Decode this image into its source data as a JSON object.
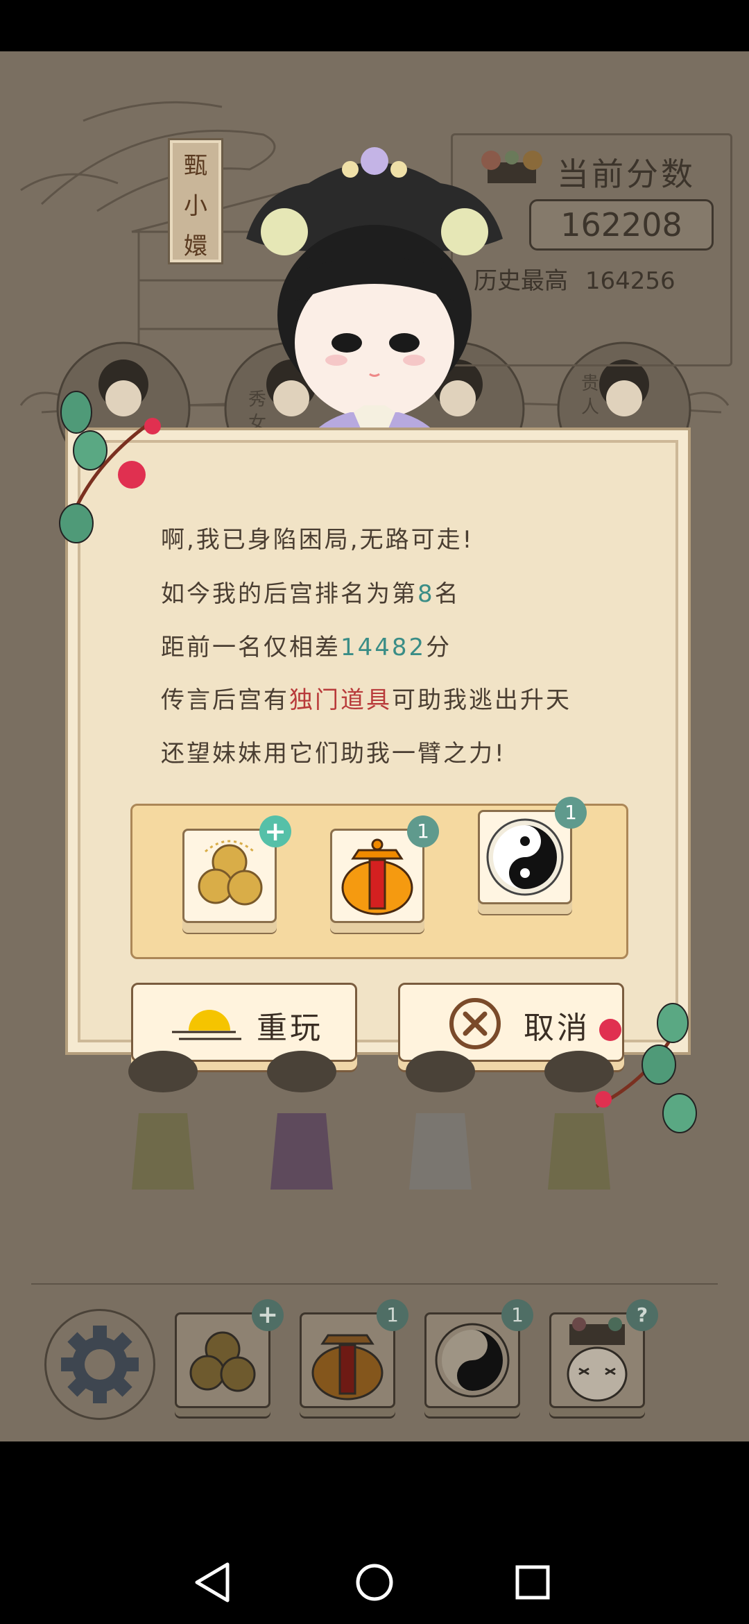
{
  "score_panel": {
    "label": "当前分数",
    "score": "162208",
    "best_label": "历史最高",
    "best_value": "164256"
  },
  "character": {
    "name_chars": [
      "甄",
      "小",
      "嬛"
    ]
  },
  "background_ranks": [
    "秀女",
    "贵人"
  ],
  "dialog": {
    "line1": "啊,我已身陷困局,无路可走!",
    "line2_prefix": "如今我的后宫排名为第",
    "line2_rank": "8",
    "line2_suffix": "名",
    "line3_prefix": "距前一名仅相差",
    "line3_points": "14482",
    "line3_suffix": "分",
    "line4_prefix": "传言后宫有",
    "line4_highlight": "独门道具",
    "line4_suffix": "可助我逃出升天",
    "line5": "还望妹妹用它们助我一臂之力!",
    "items": [
      {
        "icon": "coins-icon",
        "badge": "+"
      },
      {
        "icon": "jar-icon",
        "badge": "1"
      },
      {
        "icon": "yin-yang-icon",
        "badge": "1"
      }
    ],
    "replay_label": "重玩",
    "cancel_label": "取消"
  },
  "toolbar": {
    "items": [
      {
        "icon": "gear-icon"
      },
      {
        "icon": "coins-icon",
        "badge": "+"
      },
      {
        "icon": "jar-icon",
        "badge": "1"
      },
      {
        "icon": "yin-yang-icon",
        "badge": "1"
      },
      {
        "icon": "emperor-icon",
        "badge": "?"
      }
    ]
  },
  "colors": {
    "game_bg": "#7a6f61",
    "dialog_bg": "#f1e3c6",
    "highlight_green": "#3a8d86",
    "highlight_red": "#b83a3a",
    "badge": "#5f9a8d"
  }
}
